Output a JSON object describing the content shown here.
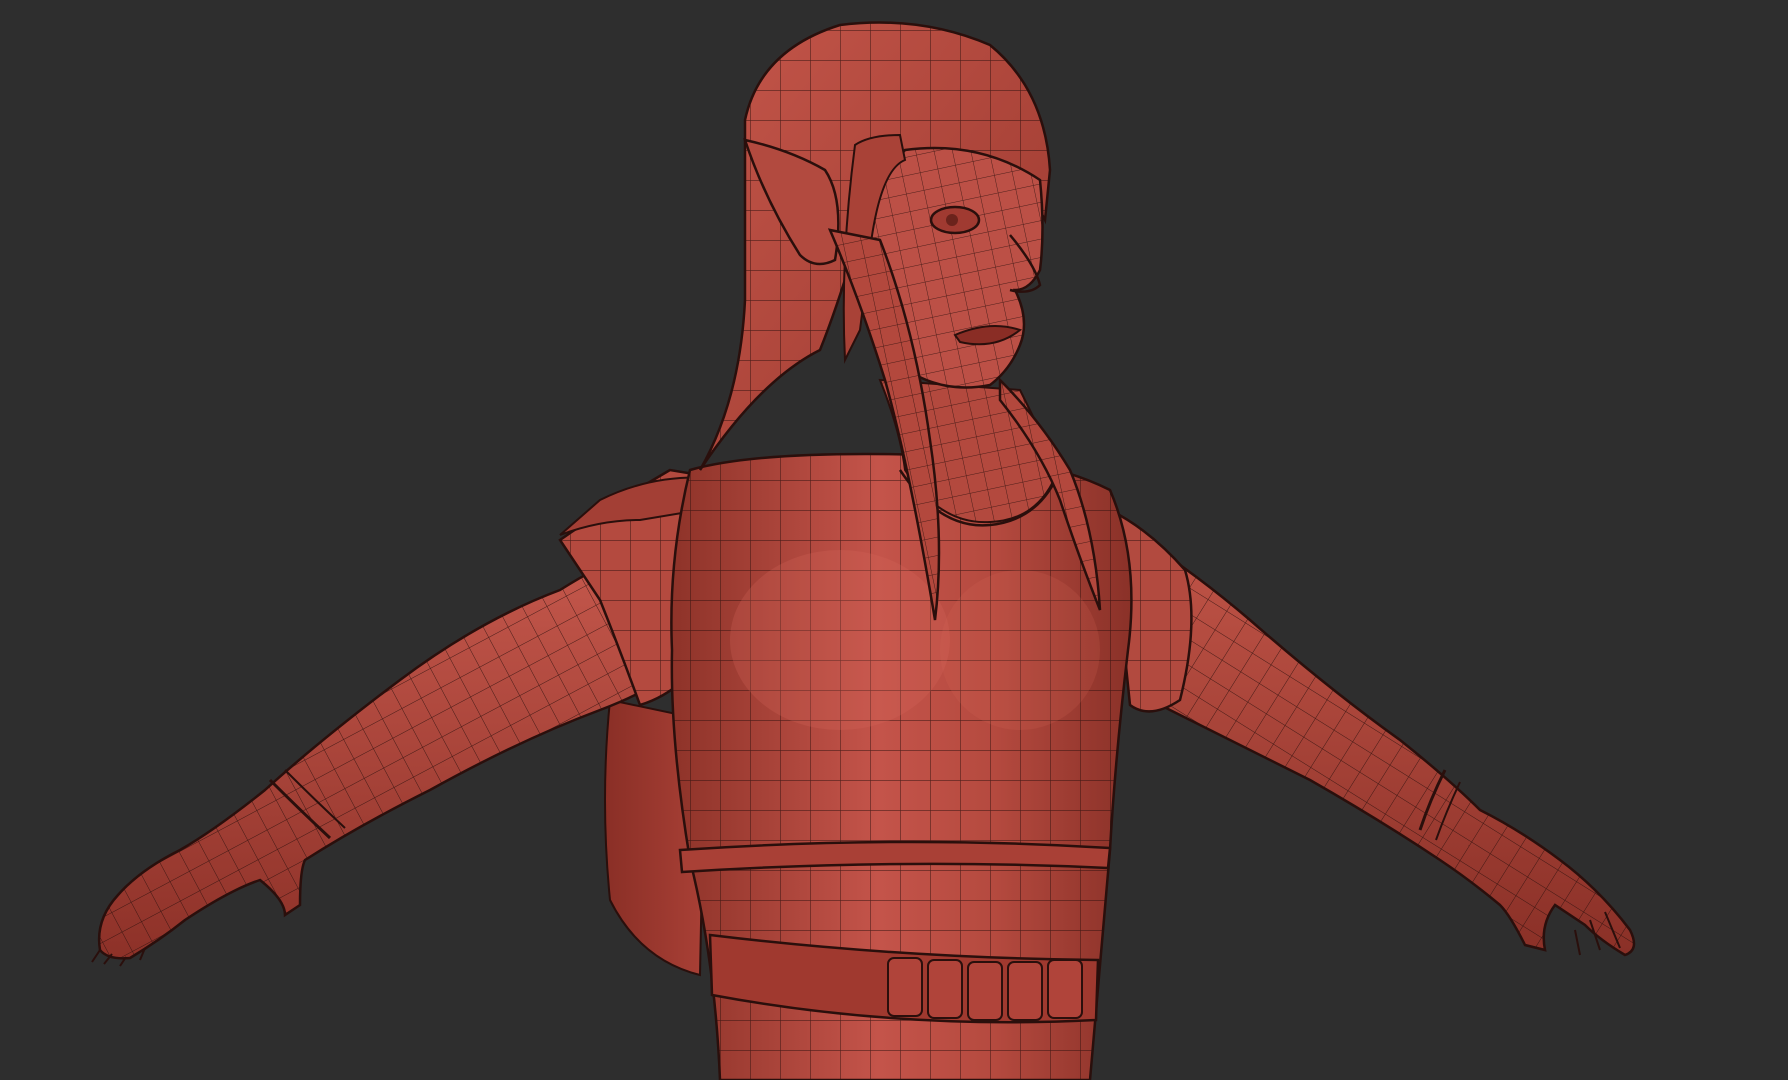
{
  "viewport": {
    "background_color": "#2e2e2e",
    "model_color": "#b8463b",
    "model_shadow_color": "#7a2a22",
    "model_highlight_color": "#d9685a",
    "wire_color": "#2a0f0c"
  }
}
